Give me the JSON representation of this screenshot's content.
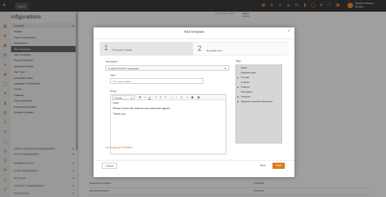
{
  "app": {
    "tab_label": "Home",
    "user_line1": "Danielle Williams",
    "user_line2": "Ministry"
  },
  "sidebar": {
    "title": "Configurations",
    "manage_label": "MANAGE",
    "items": [
      {
        "label": "Images"
      },
      {
        "label": "Roles & Workbooks"
      },
      {
        "label": "Notifications"
      },
      {
        "label": "Text Templates"
      },
      {
        "label": "Task Templates"
      },
      {
        "label": "Report Templates"
      },
      {
        "label": "Scheduled Events"
      },
      {
        "label": "User Type"
      },
      {
        "label": "Automated Tasks"
      },
      {
        "label": "Language & Translation"
      },
      {
        "label": "Invoice"
      },
      {
        "label": "Calendar"
      },
      {
        "label": "Export templates"
      },
      {
        "label": "Document templates"
      },
      {
        "label": "Software Updates"
      }
    ],
    "groups": [
      {
        "label": "USER & PERMISSION MANAGEMENT"
      },
      {
        "label": "ENTITY MANAGEMENT"
      },
      {
        "label": "BUSINESS RULES"
      },
      {
        "label": "FORM MANAGEMENT"
      },
      {
        "label": "SETTINGS"
      },
      {
        "label": "CONTRACT MANAGEMENT"
      },
      {
        "label": "SYSTEM LOG"
      }
    ]
  },
  "main": {
    "tabs": [
      {
        "label": "NOTIFYING SMS"
      },
      {
        "label": "EMAIL"
      }
    ],
    "rows": [
      {
        "name": "Scheduled contract",
        "type": "Contracts"
      },
      {
        "name": "Bill contract issue",
        "type": "Contracts"
      }
    ]
  },
  "modal": {
    "title": "Add template",
    "steps": [
      {
        "num": "1",
        "label": "Template details"
      },
      {
        "num": "2",
        "label": "Template text"
      }
    ],
    "templates_label": "Templates*",
    "templates_value": "English(Default Language)",
    "title_label": "Title *",
    "title_value": "For your review",
    "body_label": "Body *",
    "format_label": "Format",
    "body_lines": [
      "Dear,",
      "Please review the contract and send back signed.",
      "Thank you!"
    ],
    "add_language": "Add language definition",
    "tags_label": "Tags",
    "tags": [
      {
        "label": "Name",
        "expandable": false
      },
      {
        "label": "Signature type",
        "expandable": false
      },
      {
        "label": "Provider",
        "expandable": true
      },
      {
        "label": "Is active",
        "expandable": false
      },
      {
        "label": "Channel",
        "expandable": true
      },
      {
        "label": "Description",
        "expandable": false
      },
      {
        "label": "Template",
        "expandable": true
      },
      {
        "label": "Signature template attachment",
        "expandable": true
      }
    ],
    "cancel_label": "Cancel",
    "back_label": "Back",
    "save_label": "Save"
  },
  "colors": {
    "accent": "#e07a1f",
    "topbar": "#3a3a3a"
  }
}
